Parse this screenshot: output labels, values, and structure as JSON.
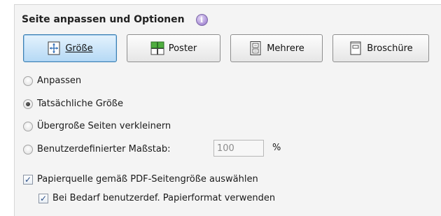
{
  "section": {
    "title": "Seite anpassen und Optionen",
    "info_icon": "info-icon"
  },
  "buttons": [
    {
      "label": "Größe",
      "icon": "size-icon",
      "active": true
    },
    {
      "label": "Poster",
      "icon": "poster-icon",
      "active": false
    },
    {
      "label": "Mehrere",
      "icon": "multiple-pages-icon",
      "active": false
    },
    {
      "label": "Broschüre",
      "icon": "booklet-icon",
      "active": false
    }
  ],
  "radio_options": [
    {
      "label": "Anpassen",
      "selected": false
    },
    {
      "label": "Tatsächliche Größe",
      "selected": true
    },
    {
      "label": "Übergroße Seiten verkleinern",
      "selected": false
    },
    {
      "label": "Benutzerdefinierter Maßstab:",
      "selected": false
    }
  ],
  "custom_scale": {
    "value": "100",
    "unit": "%"
  },
  "checkboxes": [
    {
      "label": "Papierquelle gemäß PDF-Seitengröße auswählen",
      "checked": true
    },
    {
      "label": "Bei Bedarf benutzerdef. Papierformat verwenden",
      "checked": true
    }
  ],
  "colors": {
    "active_button": "#b5d9f5",
    "active_border": "#3c7fb1",
    "panel_bg": "#f4f4f4"
  }
}
